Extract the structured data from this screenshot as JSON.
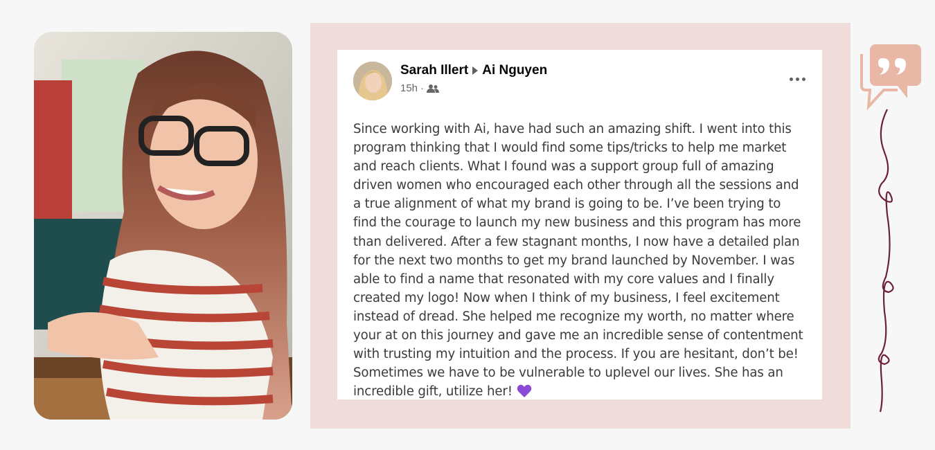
{
  "post": {
    "author": "Sarah Illert",
    "recipient": "Ai Nguyen",
    "time": "15h",
    "separator": "·",
    "body": "Since working with Ai, have had such an amazing shift. I went into this program thinking that I would find some tips/tricks to help me market and reach clients. What I found was a support group full of amazing driven women who encouraged each other through all the sessions and a true alignment of what my brand is going to be. I’ve been trying to find the courage to launch my new business and this program has more than delivered. After a few stagnant months, I now have a detailed plan for the next two months to get my brand launched by November. I was able to find a name that resonated with my core values and I finally created my logo! Now when I think of my business, I feel excitement instead of dread. She helped me recognize my worth, no matter where your at on this journey and gave me an incredible sense of contentment with trusting my intuition and the process. If you are hesitant, don’t be! Sometimes we have to be vulnerable to uplevel our lives. She has an incredible gift, utilize her!"
  },
  "icons": {
    "audience": "friends-icon",
    "more": "more-options-icon",
    "emoji": "purple-heart-icon",
    "decor": "quote-bubble-icon"
  },
  "colors": {
    "panel": "#f1dcdc",
    "quote_bubble": "#e9b7a6",
    "swirl": "#6b1f3d",
    "heart": "#8a4ad6"
  }
}
